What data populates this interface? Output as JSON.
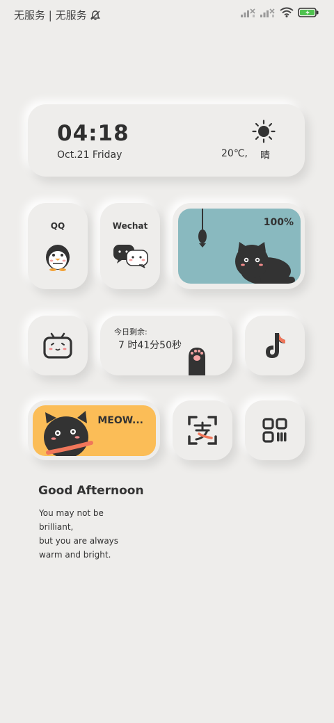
{
  "status_bar": {
    "carrier": "无服务 | 无服务",
    "icons": [
      "bell-off-icon",
      "signal-x-icon",
      "signal-x-icon",
      "wifi-icon",
      "battery-charging-icon"
    ],
    "battery_color": "#4ec24e"
  },
  "clock_widget": {
    "time": "04:18",
    "date": "Oct.21 Friday",
    "temperature": "20℃,",
    "condition": "晴",
    "icon": "sun-icon"
  },
  "apps": {
    "qq": {
      "label": "QQ",
      "icon": "qq-penguin-icon"
    },
    "wechat": {
      "label": "Wechat",
      "icon": "wechat-bubbles-icon"
    },
    "bilibili": {
      "icon": "bilibili-tv-icon"
    },
    "tiktok": {
      "icon": "tiktok-note-icon"
    },
    "alipay": {
      "icon": "alipay-scan-icon"
    },
    "qr": {
      "icon": "qr-code-icon"
    }
  },
  "battery_widget": {
    "percent": "100%",
    "color": "#89b9bf"
  },
  "timer_widget": {
    "label": "今日剩余:",
    "value": "7 时41分50秒"
  },
  "meow_widget": {
    "text": "MEOW...",
    "color": "#fbbd57"
  },
  "greeting": {
    "title": "Good Afternoon",
    "lines": [
      "You may not be",
      "brilliant,",
      "but you are always",
      "warm and bright."
    ]
  }
}
